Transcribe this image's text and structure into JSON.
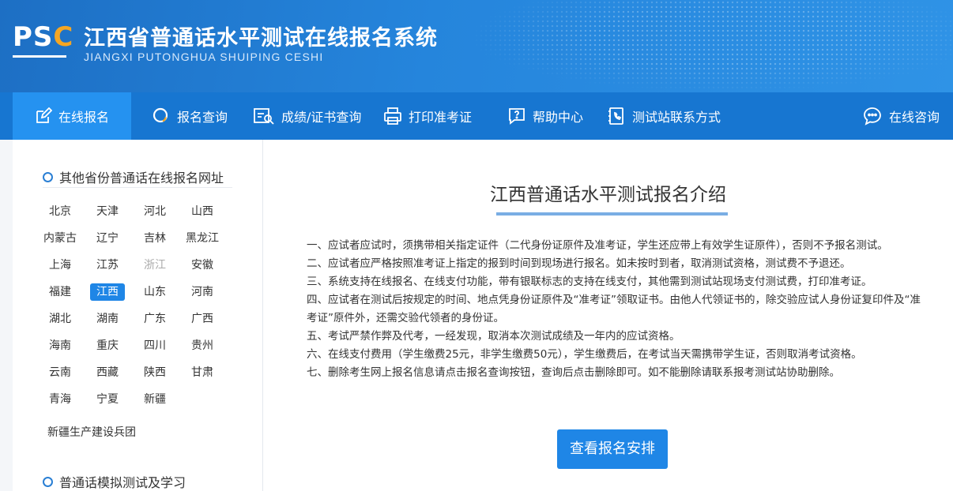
{
  "header": {
    "logo_text_p": "PS",
    "logo_text_c": "C",
    "title_cn": "江西省普通话水平测试在线报名系统",
    "title_en": "JIANGXI PUTONGHUA SHUIPING CESHI"
  },
  "nav": {
    "items": [
      {
        "label": "在线报名",
        "icon": "edit-icon",
        "active": true
      },
      {
        "label": "报名查询",
        "icon": "search-icon"
      },
      {
        "label": "成绩/证书查询",
        "icon": "certificate-search-icon"
      },
      {
        "label": "打印准考证",
        "icon": "printer-icon"
      },
      {
        "label": "帮助中心",
        "icon": "help-icon"
      },
      {
        "label": "测试站联系方式",
        "icon": "phone-book-icon"
      }
    ],
    "consult_label": "在线咨询",
    "consult_icon": "chat-bubble-icon"
  },
  "sidebar": {
    "section1_title": "其他省份普通话在线报名网址",
    "provinces": [
      [
        "北京",
        "天津",
        "河北",
        "山西"
      ],
      [
        "内蒙古",
        "辽宁",
        "吉林",
        "黑龙江"
      ],
      [
        "上海",
        "江苏",
        "浙江",
        "安徽"
      ],
      [
        "福建",
        "江西",
        "山东",
        "河南"
      ],
      [
        "湖北",
        "湖南",
        "广东",
        "广西"
      ],
      [
        "海南",
        "重庆",
        "四川",
        "贵州"
      ],
      [
        "云南",
        "西藏",
        "陕西",
        "甘肃"
      ],
      [
        "青海",
        "宁夏",
        "新疆"
      ]
    ],
    "active_province": "江西",
    "disabled_province": "浙江",
    "extra_item": "新疆生产建设兵团",
    "section2_title": "普通话模拟测试及学习"
  },
  "main": {
    "title": "江西普通话水平测试报名介绍",
    "rules": [
      "一、应试者应试时，须携带相关指定证件（二代身份证原件及准考证，学生还应带上有效学生证原件），否则不予报名测试。",
      "二、应试者应严格按照准考证上指定的报到时间到现场进行报名。如未按时到者，取消测试资格，测试费不予退还。",
      "三、系统支持在线报名、在线支付功能，带有银联标志的支持在线支付，其他需到测试站现场支付测试费，打印准考证。",
      "四、应试者在测试后按规定的时间、地点凭身份证原件及“准考证”领取证书。由他人代领证书的，除交验应试人身份证复印件及“准考证”原件外，还需交验代领者的身份证。",
      "五、考试严禁作弊及代考，一经发现，取消本次测试成绩及一年内的应试资格。",
      "六、在线支付费用（学生缴费25元，非学生缴费50元），学生缴费后，在考试当天需携带学生证，否则取消考试资格。",
      "七、删除考生网上报名信息请点击报名查询按钮，查询后点击删除即可。如不能删除请联系报考测试站协助删除。"
    ],
    "button_label": "查看报名安排"
  },
  "colors": {
    "nav_bg": "#1776d1",
    "nav_active": "#2592f0",
    "accent": "#1f86e6",
    "logo_accent": "#f5a623"
  }
}
